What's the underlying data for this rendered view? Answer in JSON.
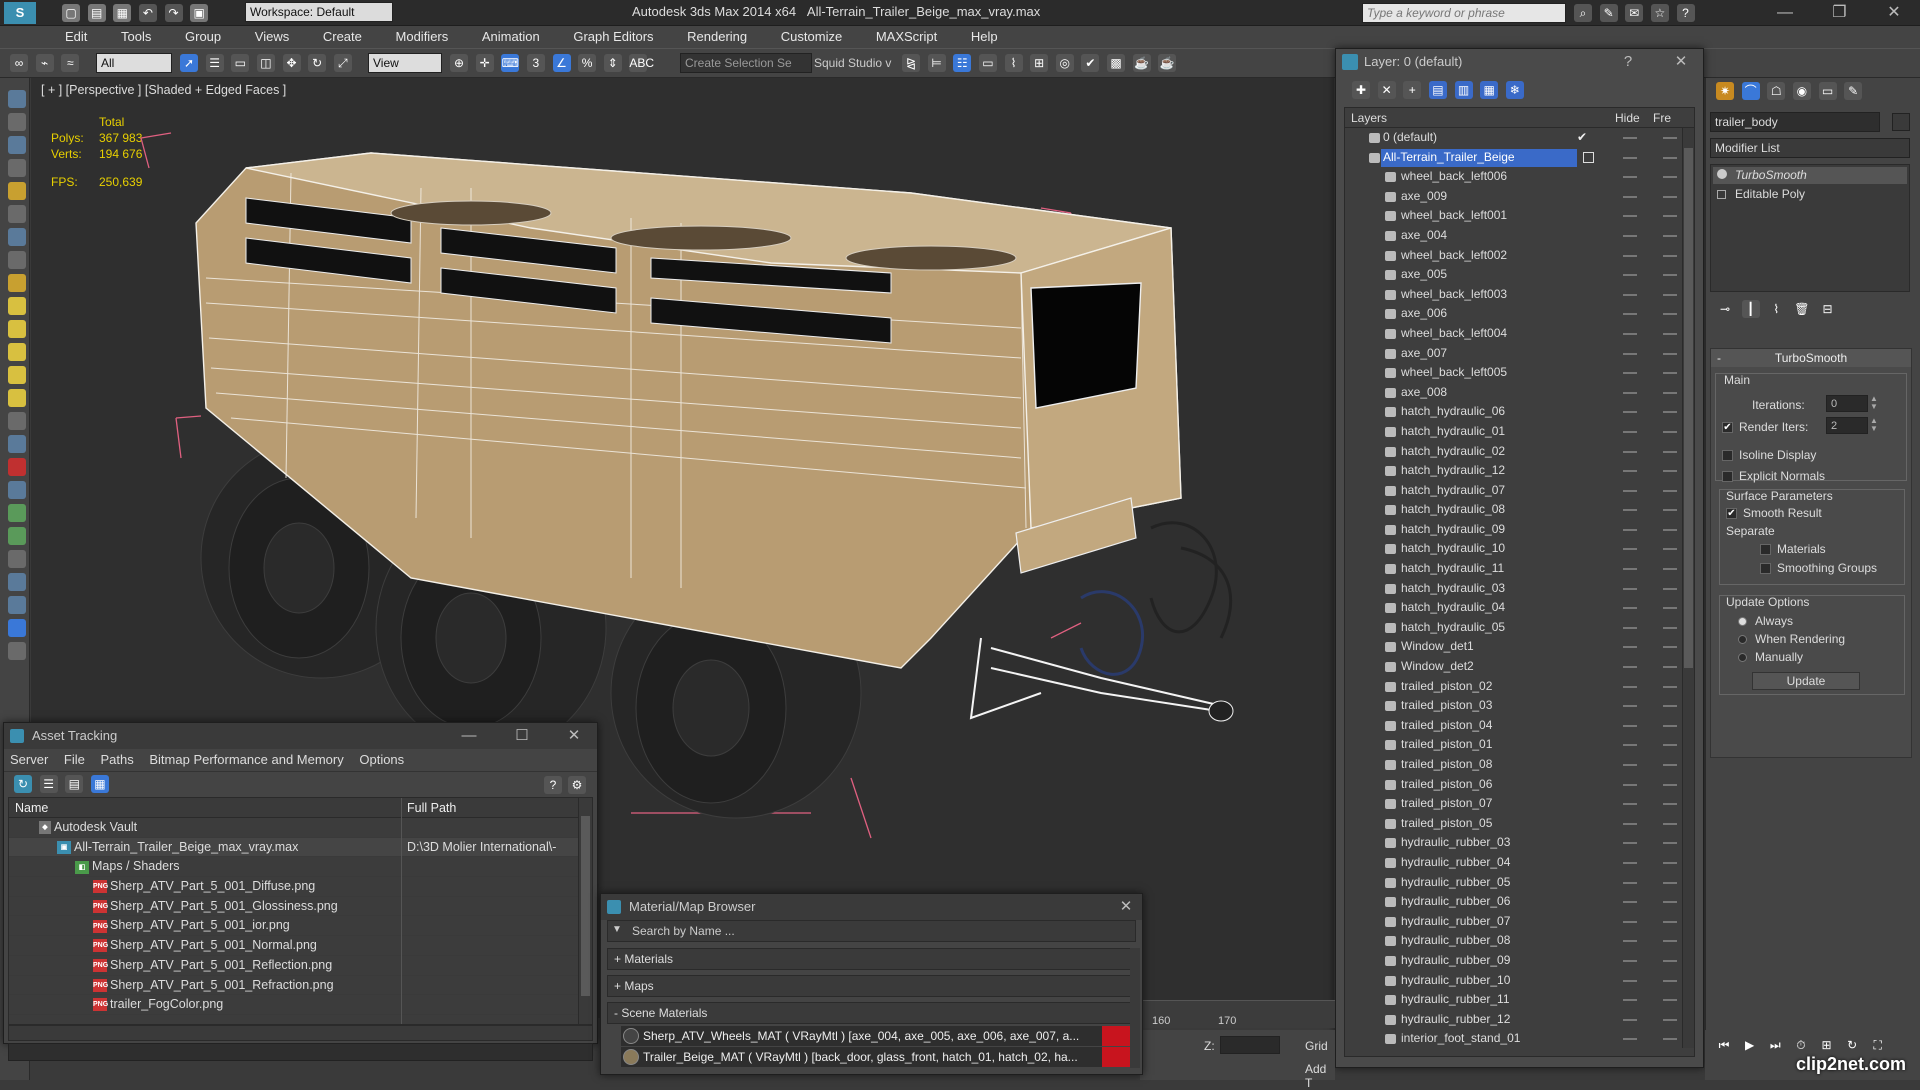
{
  "app": {
    "title": "Autodesk 3ds Max  2014 x64",
    "filename": "All-Terrain_Trailer_Beige_max_vray.max",
    "workspace": "Workspace: Default",
    "search_placeholder": "Type a keyword or phrase"
  },
  "menu": [
    "Edit",
    "Tools",
    "Group",
    "Views",
    "Create",
    "Modifiers",
    "Animation",
    "Graph Editors",
    "Rendering",
    "Customize",
    "MAXScript",
    "Help"
  ],
  "toolbar": {
    "filter": "All",
    "coord": "View",
    "selection_set": "Create Selection Se",
    "squid": "Squid Studio v"
  },
  "viewport": {
    "label": "[ + ] [Perspective ] [Shaded + Edged Faces ]",
    "stats": {
      "total_label": "Total",
      "polys_label": "Polys:",
      "polys": "367 983",
      "verts_label": "Verts:",
      "verts": "194 676",
      "fps_label": "FPS:",
      "fps": "250,639"
    }
  },
  "layer_window": {
    "title": "Layer: 0 (default)",
    "help": "?",
    "columns": {
      "layers": "Layers",
      "hide": "Hide",
      "freeze": "Fre"
    },
    "default_layer": "0 (default)",
    "selected_layer": "All-Terrain_Trailer_Beige",
    "objects": [
      "wheel_back_left006",
      "axe_009",
      "wheel_back_left001",
      "axe_004",
      "wheel_back_left002",
      "axe_005",
      "wheel_back_left003",
      "axe_006",
      "wheel_back_left004",
      "axe_007",
      "wheel_back_left005",
      "axe_008",
      "hatch_hydraulic_06",
      "hatch_hydraulic_01",
      "hatch_hydraulic_02",
      "hatch_hydraulic_12",
      "hatch_hydraulic_07",
      "hatch_hydraulic_08",
      "hatch_hydraulic_09",
      "hatch_hydraulic_10",
      "hatch_hydraulic_11",
      "hatch_hydraulic_03",
      "hatch_hydraulic_04",
      "hatch_hydraulic_05",
      "Window_det1",
      "Window_det2",
      "trailed_piston_02",
      "trailed_piston_03",
      "trailed_piston_04",
      "trailed_piston_01",
      "trailed_piston_08",
      "trailed_piston_06",
      "trailed_piston_07",
      "trailed_piston_05",
      "hydraulic_rubber_03",
      "hydraulic_rubber_04",
      "hydraulic_rubber_05",
      "hydraulic_rubber_06",
      "hydraulic_rubber_07",
      "hydraulic_rubber_08",
      "hydraulic_rubber_09",
      "hydraulic_rubber_10",
      "hydraulic_rubber_11",
      "hydraulic_rubber_12",
      "interior_foot_stand_01"
    ]
  },
  "command_panel": {
    "object_name": "trailer_body",
    "modifier_list": "Modifier List",
    "stack": [
      "TurboSmooth",
      "Editable Poly"
    ],
    "rollout_title": "TurboSmooth",
    "main_label": "Main",
    "iterations_label": "Iterations:",
    "iterations": "0",
    "render_iters_label": "Render Iters:",
    "render_iters": "2",
    "isoline": "Isoline Display",
    "explicit_normals": "Explicit Normals",
    "surface_params": "Surface Parameters",
    "smooth_result": "Smooth Result",
    "separate": "Separate",
    "materials": "Materials",
    "smoothing_groups": "Smoothing Groups",
    "update_options": "Update Options",
    "always": "Always",
    "when_rendering": "When Rendering",
    "manually": "Manually",
    "update_btn": "Update"
  },
  "asset_tracking": {
    "title": "Asset Tracking",
    "menu": [
      "Server",
      "File",
      "Paths",
      "Bitmap Performance and Memory",
      "Options"
    ],
    "col_name": "Name",
    "col_path": "Full Path",
    "vault": "Autodesk Vault",
    "file": "All-Terrain_Trailer_Beige_max_vray.max",
    "file_path": "D:\\3D Molier International\\-",
    "maps_folder": "Maps / Shaders",
    "maps": [
      "Sherp_ATV_Part_5_001_Diffuse.png",
      "Sherp_ATV_Part_5_001_Glossiness.png",
      "Sherp_ATV_Part_5_001_ior.png",
      "Sherp_ATV_Part_5_001_Normal.png",
      "Sherp_ATV_Part_5_001_Reflection.png",
      "Sherp_ATV_Part_5_001_Refraction.png",
      "trailer_FogColor.png"
    ],
    "png_badge": "PNG"
  },
  "material_browser": {
    "title": "Material/Map Browser",
    "search_placeholder": "Search by Name ...",
    "groups": [
      "+ Materials",
      "+ Maps",
      "- Scene Materials"
    ],
    "scene_materials": [
      {
        "name": "Sherp_ATV_Wheels_MAT  ( VRayMtl )  [axe_004, axe_005, axe_006, axe_007, a..."
      },
      {
        "name": "Trailer_Beige_MAT  ( VRayMtl )  [back_door, glass_front, hatch_01, hatch_02, ha..."
      }
    ]
  },
  "timeline": {
    "ticks": [
      "160",
      "170"
    ],
    "z_label": "Z:",
    "grid_label": "Grid",
    "add_label": "Add T"
  },
  "watermark": "clip2net.com",
  "colors": {
    "accent": "#3a78d8",
    "selected_layer": "#3a6ac8",
    "material_red": "#c8141e"
  }
}
